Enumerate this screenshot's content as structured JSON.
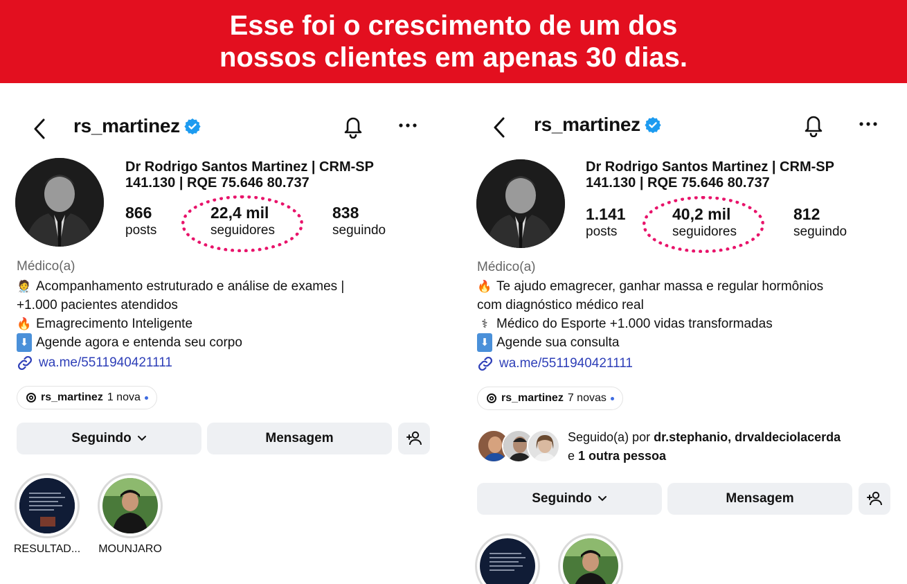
{
  "banner": {
    "line1": "Esse foi o crescimento de um dos",
    "line2": "nossos clientes em apenas 30 dias."
  },
  "colors": {
    "banner": "#e30f1f",
    "ring": "#e8136a",
    "link": "#2e3fb8",
    "verified": "#1d9bf0"
  },
  "before": {
    "username": "rs_martinez",
    "full_name_1": "Dr Rodrigo Santos Martinez | CRM-SP",
    "full_name_2": "141.130 | RQE 75.646 80.737",
    "posts": "866",
    "posts_label": "posts",
    "followers": "22,4 mil",
    "followers_label": "seguidores",
    "following": "838",
    "following_label": "seguindo",
    "category": "Médico(a)",
    "bio": [
      {
        "icon": "doctor-emoji",
        "emoji": "🧑‍⚕️",
        "text": "Acompanhamento estruturado e análise de exames |"
      },
      {
        "icon": "",
        "emoji": "",
        "text": "+1.000 pacientes atendidos"
      },
      {
        "icon": "fire-emoji",
        "emoji": "🔥",
        "text": "Emagrecimento Inteligente"
      },
      {
        "icon": "down-arrow-emoji",
        "emoji": "⬇",
        "text": "Agende agora e entenda seu corpo"
      }
    ],
    "link": "wa.me/5511940421111",
    "threads_user": "rs_martinez",
    "threads_count": "1 nova",
    "btn_following": "Seguindo",
    "btn_message": "Mensagem",
    "highlights": [
      {
        "label": "RESULTAD..."
      },
      {
        "label": "MOUNJARO"
      }
    ]
  },
  "after": {
    "username": "rs_martinez",
    "full_name_1": "Dr Rodrigo Santos Martinez | CRM-SP",
    "full_name_2": "141.130 | RQE 75.646 80.737",
    "posts": "1.141",
    "posts_label": "posts",
    "followers": "40,2 mil",
    "followers_label": "seguidores",
    "following": "812",
    "following_label": "seguindo",
    "category": "Médico(a)",
    "bio": [
      {
        "icon": "fire-emoji",
        "emoji": "🔥",
        "text": "Te ajudo emagrecer, ganhar massa e regular hormônios"
      },
      {
        "icon": "",
        "emoji": "",
        "text": "com diagnóstico médico real"
      },
      {
        "icon": "stethoscope-emoji",
        "emoji": "⚕",
        "text": "Médico do Esporte +1.000 vidas transformadas"
      },
      {
        "icon": "down-arrow-emoji",
        "emoji": "⬇",
        "text": "Agende sua consulta"
      }
    ],
    "link": "wa.me/5511940421111",
    "threads_user": "rs_martinez",
    "threads_count": "7 novas",
    "followed_prefix": "Seguido(a) por ",
    "followed_names": "dr.stephanio, drvaldeciolacerda",
    "followed_and": "e ",
    "followed_other": "1 outra pessoa",
    "btn_following": "Seguindo",
    "btn_message": "Mensagem"
  }
}
